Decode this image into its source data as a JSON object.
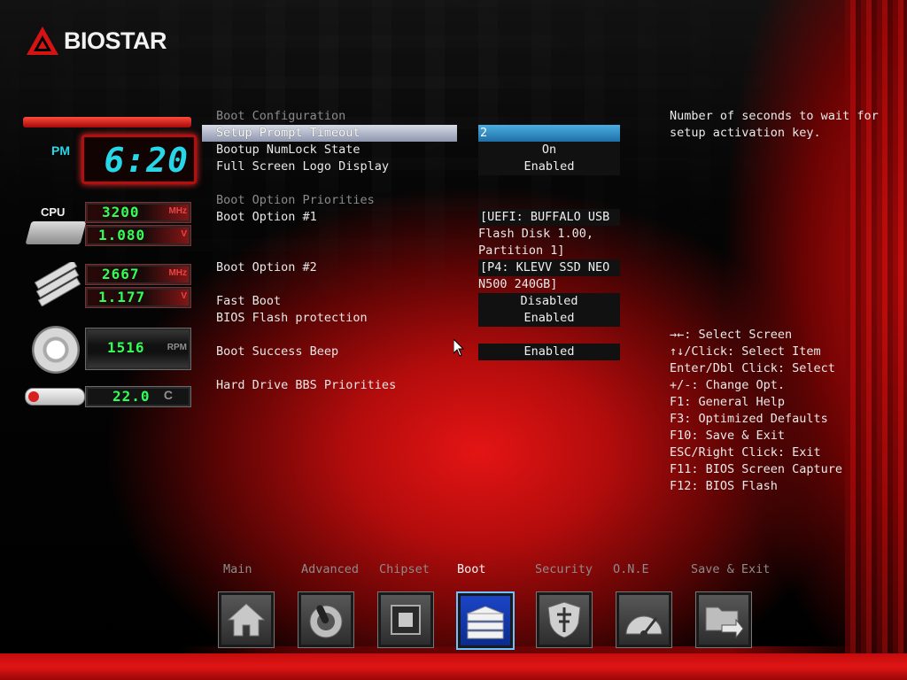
{
  "brand": "BIOSTAR",
  "colors": {
    "accent": "#e41414",
    "selected": "#2a84c4",
    "lcd_green": "#31ff57",
    "lcd_cyan": "#27d7e8"
  },
  "monitor": {
    "clock_period": "PM",
    "clock_time": "6:20",
    "cpu_label": "CPU",
    "cpu_freq": "3200",
    "cpu_freq_unit": "MHz",
    "cpu_volt": "1.080",
    "cpu_volt_unit": "V",
    "mem_freq": "2667",
    "mem_freq_unit": "MHz",
    "mem_volt": "1.177",
    "mem_volt_unit": "V",
    "fan_speed": "1516",
    "fan_unit": "RPM",
    "temp": "22.0",
    "temp_unit": "C"
  },
  "settings": {
    "group_boot_config": "Boot Configuration",
    "setup_prompt_timeout": {
      "label": "Setup Prompt Timeout",
      "value": "2"
    },
    "numlock": {
      "label": "Bootup NumLock State",
      "value": "On"
    },
    "logo_display": {
      "label": "Full Screen Logo Display",
      "value": "Enabled"
    },
    "group_boot_priorities": "Boot Option Priorities",
    "boot_option_1": {
      "label": "Boot Option #1",
      "lines": [
        "[UEFI: BUFFALO USB",
        "Flash Disk 1.00,",
        "Partition 1]"
      ]
    },
    "boot_option_2": {
      "label": "Boot Option #2",
      "lines": [
        "[P4: KLEVV SSD NEO",
        "N500 240GB]"
      ]
    },
    "fast_boot": {
      "label": "Fast Boot",
      "value": "Disabled"
    },
    "bios_flash_protection": {
      "label": "BIOS Flash protection",
      "value": "Enabled"
    },
    "boot_success_beep": {
      "label": "Boot Success Beep",
      "value": "Enabled"
    },
    "hdd_bbs_priorities": {
      "label": "Hard Drive BBS Priorities"
    }
  },
  "help": {
    "description_line1": "Number of seconds to wait for",
    "description_line2": "setup activation key.",
    "keys": [
      "→←: Select Screen",
      "↑↓/Click: Select Item",
      "Enter/Dbl Click: Select",
      "+/-: Change Opt.",
      "F1: General Help",
      "F3: Optimized Defaults",
      "F10: Save & Exit",
      "ESC/Right Click: Exit",
      "F11: BIOS Screen Capture",
      "F12: BIOS Flash"
    ]
  },
  "tabs": [
    {
      "label": "Main",
      "icon": "home-icon"
    },
    {
      "label": "Advanced",
      "icon": "joystick-icon"
    },
    {
      "label": "Chipset",
      "icon": "chip-icon"
    },
    {
      "label": "Boot",
      "icon": "drive-stack-icon",
      "active": true
    },
    {
      "label": "Security",
      "icon": "shield-icon"
    },
    {
      "label": "O.N.E",
      "icon": "speedometer-icon"
    },
    {
      "label": "Save & Exit",
      "icon": "folder-exit-icon"
    }
  ]
}
